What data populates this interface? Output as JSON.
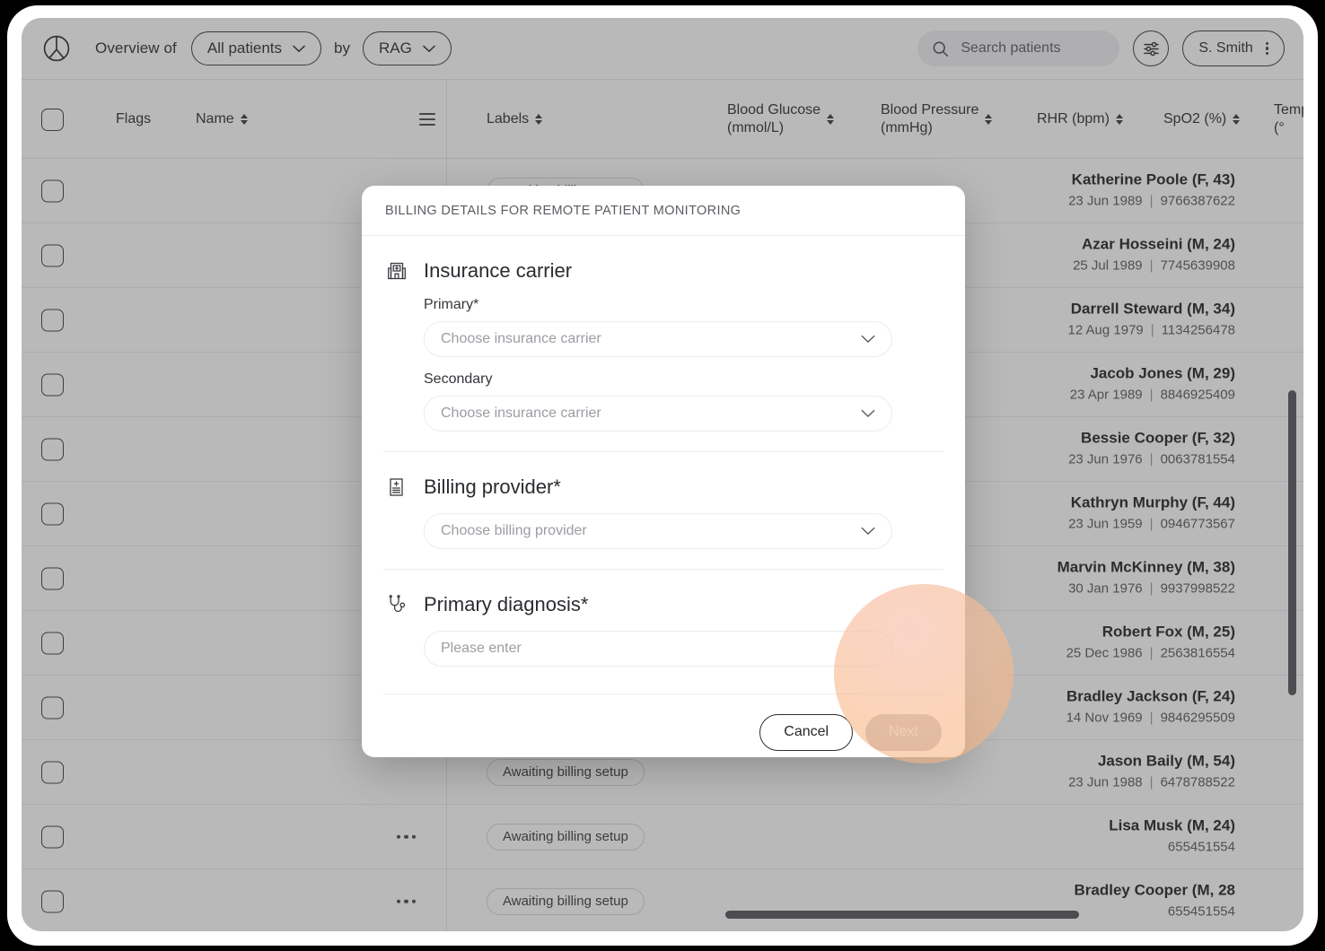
{
  "topbar": {
    "logo_icon": "patient-logo-icon",
    "overview_label": "Overview of",
    "patients_filter": "All patients",
    "by_label": "by",
    "grouping_filter": "RAG",
    "search_placeholder": "Search patients",
    "settings_icon": "sliders-icon",
    "user_name": "S. Smith",
    "user_menu_icon": "kebab-menu-icon"
  },
  "table": {
    "columns": {
      "flags": "Flags",
      "name": "Name",
      "labels": "Labels",
      "blood_glucose_l1": "Blood Glucose",
      "blood_glucose_l2": "(mmol/L)",
      "blood_pressure_l1": "Blood Pressure",
      "blood_pressure_l2": "(mmHg)",
      "rhr": "RHR (bpm)",
      "spo2": "SpO2 (%)",
      "temp": "Temp (°"
    },
    "rows": [
      {
        "name": "Katherine Poole (F, 43)",
        "dob": "23 Jun 1989",
        "id": "9766387622",
        "label": "Awaiting billing setup",
        "more": true
      },
      {
        "name": "Azar Hosseini (M, 24)",
        "dob": "25 Jul 1989",
        "id": "7745639908",
        "label": "",
        "more": false
      },
      {
        "name": "Darrell Steward (M, 34)",
        "dob": "12 Aug 1979",
        "id": "1134256478",
        "label": "",
        "more": false
      },
      {
        "name": "Jacob Jones (M, 29)",
        "dob": "23 Apr 1989",
        "id": "8846925409",
        "label": "",
        "more": false
      },
      {
        "name": "Bessie Cooper (F, 32)",
        "dob": "23 Jun 1976",
        "id": "0063781554",
        "label": "",
        "more": false
      },
      {
        "name": "Kathryn Murphy (F, 44)",
        "dob": "23 Jun 1959",
        "id": "0946773567",
        "label": "",
        "more": false
      },
      {
        "name": "Marvin McKinney (M, 38)",
        "dob": "30 Jan 1976",
        "id": "9937998522",
        "label": "",
        "more": false
      },
      {
        "name": "Robert Fox (M, 25)",
        "dob": "25 Dec 1986",
        "id": "2563816554",
        "label": "",
        "more": false
      },
      {
        "name": "Bradley Jackson (F, 24)",
        "dob": "14 Nov 1969",
        "id": "9846295509",
        "label": "",
        "more": false
      },
      {
        "name": "Jason Baily (M, 54)",
        "dob": "23 Jun 1988",
        "id": "6478788522",
        "label": "Awaiting billing setup",
        "more": false
      },
      {
        "name": "Lisa Musk (M, 24)",
        "dob": "",
        "id": "655451554",
        "label": "Awaiting billing setup",
        "more": true
      },
      {
        "name": "Bradley Cooper (M, 28",
        "dob": "",
        "id": "655451554",
        "label": "Awaiting billing setup",
        "more": true
      }
    ]
  },
  "modal": {
    "title": "BILLING DETAILS FOR REMOTE PATIENT MONITORING",
    "sections": [
      {
        "icon": "hospital-icon",
        "title": "Insurance carrier",
        "fields": [
          {
            "label": "Primary*",
            "placeholder": "Choose insurance carrier",
            "type": "select"
          },
          {
            "label": "Secondary",
            "placeholder": "Choose insurance carrier",
            "type": "select"
          }
        ]
      },
      {
        "icon": "clipboard-plus-icon",
        "title": "Billing provider*",
        "fields": [
          {
            "label": "",
            "placeholder": "Choose billing provider",
            "type": "select"
          }
        ]
      },
      {
        "icon": "stethoscope-icon",
        "title": "Primary diagnosis*",
        "fields": [
          {
            "label": "",
            "placeholder": "Please enter",
            "type": "text"
          }
        ]
      }
    ],
    "cancel_label": "Cancel",
    "next_label": "Next"
  },
  "colors": {
    "spotlight": "#f7c4b2",
    "next_disabled": "#bfbfc4",
    "dim_overlay": "#3c3c3e"
  }
}
